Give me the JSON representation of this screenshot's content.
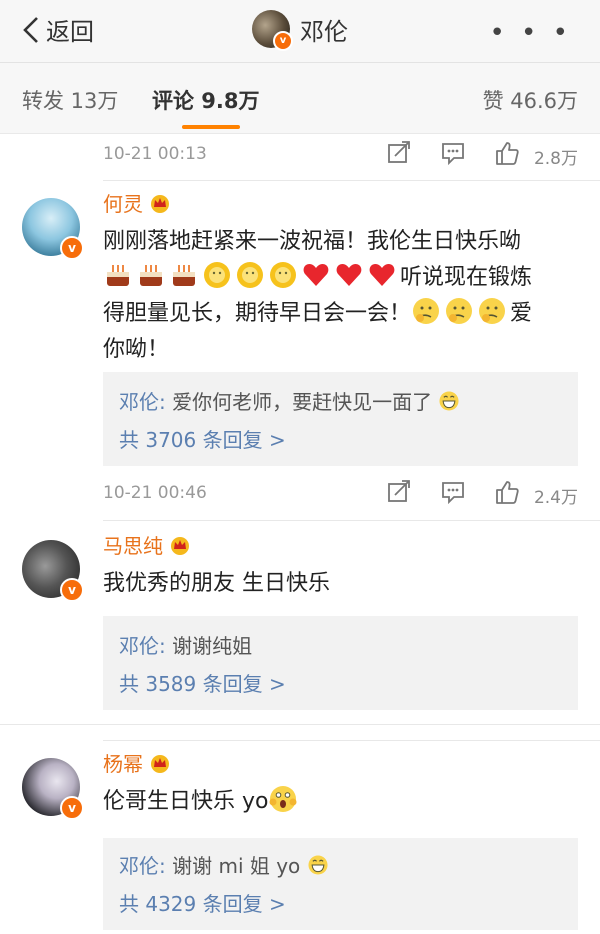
{
  "header": {
    "back_label": "返回",
    "title": "邓伦",
    "more": "• • •"
  },
  "tabs": [
    {
      "label": "转发 13万"
    },
    {
      "label": "评论 9.8万"
    },
    {
      "label": "赞 46.6万"
    }
  ],
  "meta_rows": [
    {
      "time": "10-21 00:13",
      "likes": "2.8万"
    },
    {
      "time": "10-21 00:46",
      "likes": "2.4万"
    }
  ],
  "comments": [
    {
      "user": "何灵",
      "text_1": "刚刚落地赶紧来一波祝福！我伦生日快乐呦",
      "text_2": "听说现在锻炼",
      "text_3": "得胆量见长，期待早日会一会！",
      "text_3b": "爱",
      "text_4": "你呦！",
      "reply_author": "邓伦:",
      "reply_text": " 爱你何老师，要赶快见一面了",
      "reply_count": "共 3706 条回复 >"
    },
    {
      "user": "马思纯",
      "text_1": "我优秀的朋友 生日快乐",
      "reply_author": "邓伦:",
      "reply_text": " 谢谢纯姐",
      "reply_count": "共 3589 条回复 >"
    },
    {
      "user": "杨幂",
      "text_1": "伦哥生日快乐 yo",
      "reply_author": "邓伦:",
      "reply_text": " 谢谢 mi 姐 yo",
      "reply_count": "共 4329 条回复 >"
    }
  ],
  "colors": {
    "accent": "#ff8200",
    "username": "#e8731c",
    "link": "#5b7fb0",
    "badge": "#f76d0a"
  }
}
